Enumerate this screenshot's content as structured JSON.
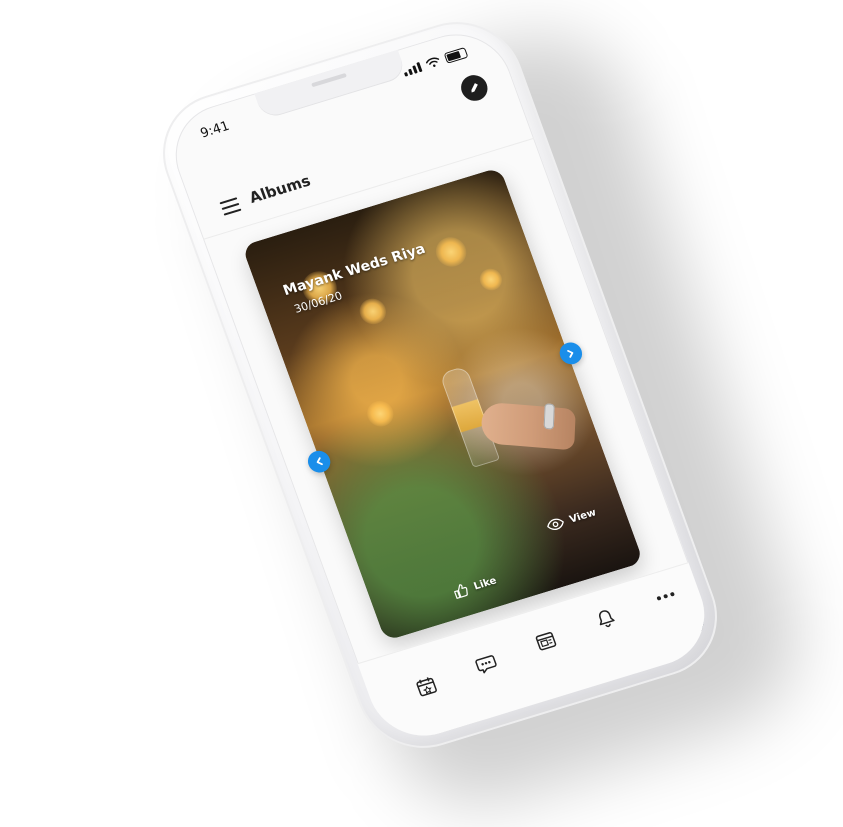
{
  "status_bar": {
    "time": "9:41"
  },
  "header": {
    "title": "Albums"
  },
  "album_card": {
    "title": "Mayank Weds Riya",
    "date": "30/06/20",
    "actions": {
      "view_label": "View",
      "like_label": "Like"
    }
  },
  "colors": {
    "accent": "#1A8EEA",
    "edit_button": "#1E1E1E",
    "text_primary": "#222222"
  },
  "icons": {
    "edit": "pencil-icon",
    "menu": "hamburger-menu-icon",
    "view": "eye-icon",
    "like": "thumbs-up-icon",
    "left_arrow": "chevron-left-icon",
    "right_arrow": "chevron-right-icon",
    "nav_calendar": "calendar-icon",
    "nav_chat": "chat-icon",
    "nav_media": "media-icon",
    "nav_notifications": "bell-icon",
    "nav_more": "more-icon"
  }
}
